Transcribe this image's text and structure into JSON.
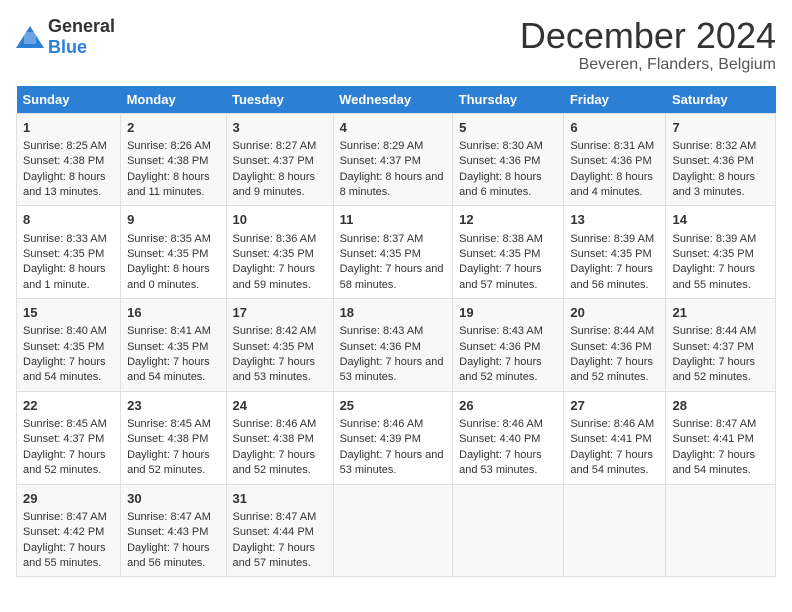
{
  "logo": {
    "general": "General",
    "blue": "Blue"
  },
  "title": "December 2024",
  "subtitle": "Beveren, Flanders, Belgium",
  "headers": [
    "Sunday",
    "Monday",
    "Tuesday",
    "Wednesday",
    "Thursday",
    "Friday",
    "Saturday"
  ],
  "weeks": [
    [
      {
        "day": "1",
        "sunrise": "Sunrise: 8:25 AM",
        "sunset": "Sunset: 4:38 PM",
        "daylight": "Daylight: 8 hours and 13 minutes."
      },
      {
        "day": "2",
        "sunrise": "Sunrise: 8:26 AM",
        "sunset": "Sunset: 4:38 PM",
        "daylight": "Daylight: 8 hours and 11 minutes."
      },
      {
        "day": "3",
        "sunrise": "Sunrise: 8:27 AM",
        "sunset": "Sunset: 4:37 PM",
        "daylight": "Daylight: 8 hours and 9 minutes."
      },
      {
        "day": "4",
        "sunrise": "Sunrise: 8:29 AM",
        "sunset": "Sunset: 4:37 PM",
        "daylight": "Daylight: 8 hours and 8 minutes."
      },
      {
        "day": "5",
        "sunrise": "Sunrise: 8:30 AM",
        "sunset": "Sunset: 4:36 PM",
        "daylight": "Daylight: 8 hours and 6 minutes."
      },
      {
        "day": "6",
        "sunrise": "Sunrise: 8:31 AM",
        "sunset": "Sunset: 4:36 PM",
        "daylight": "Daylight: 8 hours and 4 minutes."
      },
      {
        "day": "7",
        "sunrise": "Sunrise: 8:32 AM",
        "sunset": "Sunset: 4:36 PM",
        "daylight": "Daylight: 8 hours and 3 minutes."
      }
    ],
    [
      {
        "day": "8",
        "sunrise": "Sunrise: 8:33 AM",
        "sunset": "Sunset: 4:35 PM",
        "daylight": "Daylight: 8 hours and 1 minute."
      },
      {
        "day": "9",
        "sunrise": "Sunrise: 8:35 AM",
        "sunset": "Sunset: 4:35 PM",
        "daylight": "Daylight: 8 hours and 0 minutes."
      },
      {
        "day": "10",
        "sunrise": "Sunrise: 8:36 AM",
        "sunset": "Sunset: 4:35 PM",
        "daylight": "Daylight: 7 hours and 59 minutes."
      },
      {
        "day": "11",
        "sunrise": "Sunrise: 8:37 AM",
        "sunset": "Sunset: 4:35 PM",
        "daylight": "Daylight: 7 hours and 58 minutes."
      },
      {
        "day": "12",
        "sunrise": "Sunrise: 8:38 AM",
        "sunset": "Sunset: 4:35 PM",
        "daylight": "Daylight: 7 hours and 57 minutes."
      },
      {
        "day": "13",
        "sunrise": "Sunrise: 8:39 AM",
        "sunset": "Sunset: 4:35 PM",
        "daylight": "Daylight: 7 hours and 56 minutes."
      },
      {
        "day": "14",
        "sunrise": "Sunrise: 8:39 AM",
        "sunset": "Sunset: 4:35 PM",
        "daylight": "Daylight: 7 hours and 55 minutes."
      }
    ],
    [
      {
        "day": "15",
        "sunrise": "Sunrise: 8:40 AM",
        "sunset": "Sunset: 4:35 PM",
        "daylight": "Daylight: 7 hours and 54 minutes."
      },
      {
        "day": "16",
        "sunrise": "Sunrise: 8:41 AM",
        "sunset": "Sunset: 4:35 PM",
        "daylight": "Daylight: 7 hours and 54 minutes."
      },
      {
        "day": "17",
        "sunrise": "Sunrise: 8:42 AM",
        "sunset": "Sunset: 4:35 PM",
        "daylight": "Daylight: 7 hours and 53 minutes."
      },
      {
        "day": "18",
        "sunrise": "Sunrise: 8:43 AM",
        "sunset": "Sunset: 4:36 PM",
        "daylight": "Daylight: 7 hours and 53 minutes."
      },
      {
        "day": "19",
        "sunrise": "Sunrise: 8:43 AM",
        "sunset": "Sunset: 4:36 PM",
        "daylight": "Daylight: 7 hours and 52 minutes."
      },
      {
        "day": "20",
        "sunrise": "Sunrise: 8:44 AM",
        "sunset": "Sunset: 4:36 PM",
        "daylight": "Daylight: 7 hours and 52 minutes."
      },
      {
        "day": "21",
        "sunrise": "Sunrise: 8:44 AM",
        "sunset": "Sunset: 4:37 PM",
        "daylight": "Daylight: 7 hours and 52 minutes."
      }
    ],
    [
      {
        "day": "22",
        "sunrise": "Sunrise: 8:45 AM",
        "sunset": "Sunset: 4:37 PM",
        "daylight": "Daylight: 7 hours and 52 minutes."
      },
      {
        "day": "23",
        "sunrise": "Sunrise: 8:45 AM",
        "sunset": "Sunset: 4:38 PM",
        "daylight": "Daylight: 7 hours and 52 minutes."
      },
      {
        "day": "24",
        "sunrise": "Sunrise: 8:46 AM",
        "sunset": "Sunset: 4:38 PM",
        "daylight": "Daylight: 7 hours and 52 minutes."
      },
      {
        "day": "25",
        "sunrise": "Sunrise: 8:46 AM",
        "sunset": "Sunset: 4:39 PM",
        "daylight": "Daylight: 7 hours and 53 minutes."
      },
      {
        "day": "26",
        "sunrise": "Sunrise: 8:46 AM",
        "sunset": "Sunset: 4:40 PM",
        "daylight": "Daylight: 7 hours and 53 minutes."
      },
      {
        "day": "27",
        "sunrise": "Sunrise: 8:46 AM",
        "sunset": "Sunset: 4:41 PM",
        "daylight": "Daylight: 7 hours and 54 minutes."
      },
      {
        "day": "28",
        "sunrise": "Sunrise: 8:47 AM",
        "sunset": "Sunset: 4:41 PM",
        "daylight": "Daylight: 7 hours and 54 minutes."
      }
    ],
    [
      {
        "day": "29",
        "sunrise": "Sunrise: 8:47 AM",
        "sunset": "Sunset: 4:42 PM",
        "daylight": "Daylight: 7 hours and 55 minutes."
      },
      {
        "day": "30",
        "sunrise": "Sunrise: 8:47 AM",
        "sunset": "Sunset: 4:43 PM",
        "daylight": "Daylight: 7 hours and 56 minutes."
      },
      {
        "day": "31",
        "sunrise": "Sunrise: 8:47 AM",
        "sunset": "Sunset: 4:44 PM",
        "daylight": "Daylight: 7 hours and 57 minutes."
      },
      {
        "day": "",
        "sunrise": "",
        "sunset": "",
        "daylight": ""
      },
      {
        "day": "",
        "sunrise": "",
        "sunset": "",
        "daylight": ""
      },
      {
        "day": "",
        "sunrise": "",
        "sunset": "",
        "daylight": ""
      },
      {
        "day": "",
        "sunrise": "",
        "sunset": "",
        "daylight": ""
      }
    ]
  ]
}
